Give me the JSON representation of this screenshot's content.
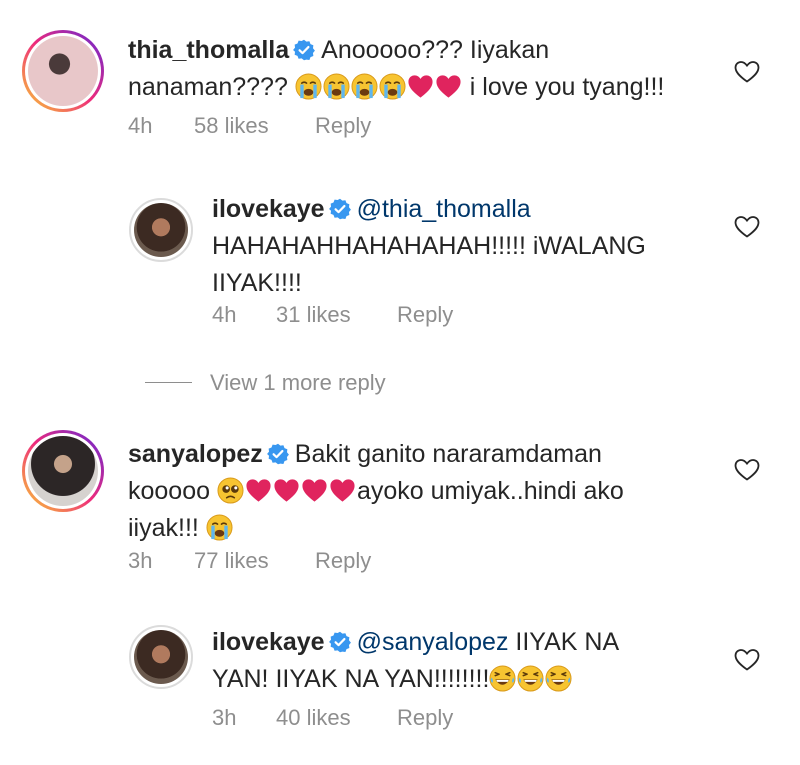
{
  "comments": [
    {
      "username": "thia_thomalla",
      "verified": true,
      "line1": "Anooooo??? Iiyakan",
      "line2_text": "nanaman????",
      "line2_tail": "i love you tyang!!!",
      "emojis": [
        "crying-face",
        "crying-face",
        "crying-face",
        "crying-face",
        "red-heart",
        "red-heart"
      ],
      "time": "4h",
      "likes": "58 likes",
      "reply": "Reply"
    },
    {
      "username": "ilovekaye",
      "verified": true,
      "mention": "@thia_thomalla",
      "line2": "HAHAHAHHAHAHAHAH!!!!! iWALANG",
      "line3": "IIYAK!!!!",
      "time": "4h",
      "likes": "31 likes",
      "reply": "Reply"
    },
    {
      "username": "sanyalopez",
      "verified": true,
      "line1": "Bakit ganito nararamdaman",
      "line2_text": "kooooo",
      "line2_tail": "ayoko umiyak..hindi ako",
      "line3": "iiyak!!!",
      "emojis": [
        "pleading-face",
        "red-heart",
        "red-heart",
        "red-heart",
        "red-heart",
        "crying-face"
      ],
      "time": "3h",
      "likes": "77 likes",
      "reply": "Reply"
    },
    {
      "username": "ilovekaye",
      "verified": true,
      "mention": "@sanyalopez",
      "line1_tail": "IIYAK NA",
      "line2": "YAN! IIYAK NA YAN!!!!!!!!",
      "emojis": [
        "laughing-face",
        "laughing-face",
        "laughing-face"
      ],
      "time": "3h",
      "likes": "40 likes",
      "reply": "Reply"
    }
  ],
  "view_more": "View 1 more reply",
  "colors": {
    "verified": "#3897f0",
    "mention": "#00376b",
    "meta": "#8e8e8e",
    "heart_emoji": "#e0245e"
  }
}
